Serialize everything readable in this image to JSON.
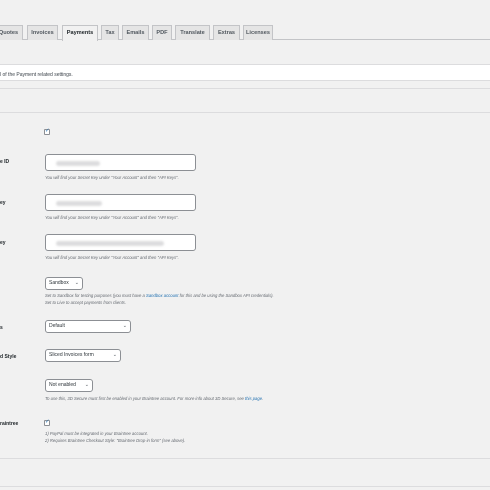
{
  "tabs": [
    {
      "label": "Quotes"
    },
    {
      "label": "Invoices"
    },
    {
      "label": "Payments"
    },
    {
      "label": "Tax"
    },
    {
      "label": "Emails"
    },
    {
      "label": "PDF"
    },
    {
      "label": "Translate"
    },
    {
      "label": "Extras"
    },
    {
      "label": "Licenses"
    }
  ],
  "intro": "l of the Payment related settings.",
  "labels": {
    "enable": "",
    "merchant_id": "e ID",
    "public_key": "ey",
    "private_key": "ey",
    "environment": "",
    "currency": "s",
    "checkout_style": "d Style",
    "three_d_secure": "",
    "paypal": "raintree"
  },
  "desc": {
    "merchant_id": "You will find your Secret Key under \"Your Account\" and then \"API Keys\".",
    "public_key": "You will find your Secret Key under \"Your Account\" and then \"API Keys\".",
    "private_key": "You will find your Secret Key under \"Your Account\" and then \"API Keys\".",
    "env_line1_a": "Set to Sandbox for testing purposes (you must have a",
    "env_link": "Sandbox account",
    "env_line1_b": "for this and be using the Sandbox API credentials).",
    "env_line2": "Set to Live to accept payments from clients.",
    "secure_a": "To use this, 3D Secure must first be enabled in your Braintree account. For more info about 3D Secure, see",
    "secure_link": "this page",
    "paypal_line1": "1) PayPal must be integrated in your Braintree account.",
    "paypal_line2": "2) Requires Braintree Checkout Style: \"Braintree Drop-in form\" (see above)."
  },
  "selects": {
    "environment": "Sandbox",
    "currency": "Default",
    "checkout_style": "Sliced Invoices form",
    "three_d_secure": "Not enabled"
  },
  "checkbox_mark": "✓",
  "icons": {
    "caret": "chevron-down-icon",
    "check": "check-icon"
  }
}
